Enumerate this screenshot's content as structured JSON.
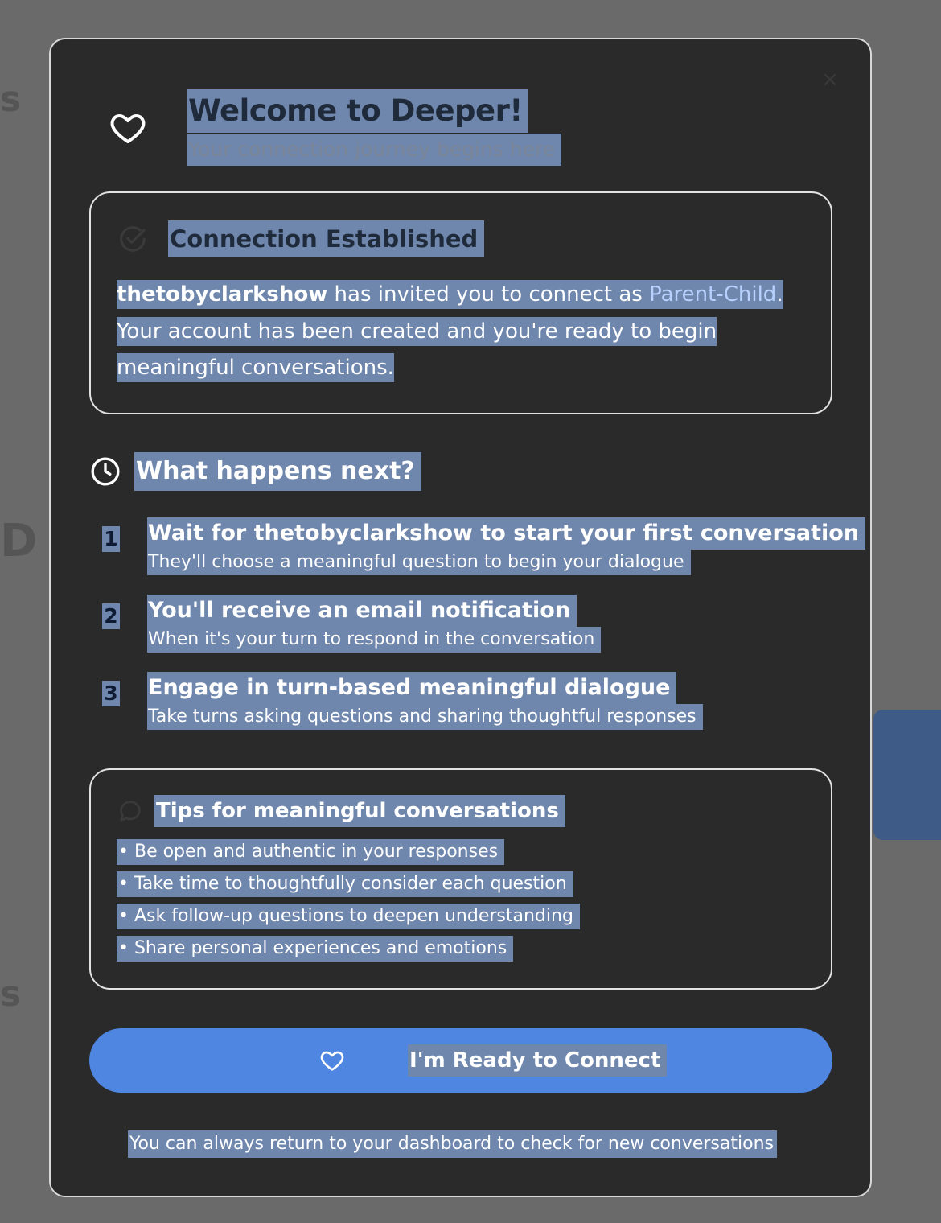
{
  "modal": {
    "close_icon": "close-icon",
    "header_icon": "heart-icon",
    "title": "Welcome to Deeper!",
    "subtitle": "Your connection journey begins here"
  },
  "connection": {
    "icon": "check-circle-icon",
    "title": "Connection Established",
    "inviter": "thetobyclarkshow",
    "text_invited": " has invited you to connect as ",
    "relationship": "Parent-Child",
    "period": ".",
    "line2": "Your account has been created and you're ready to begin",
    "line3": "meaningful conversations."
  },
  "next": {
    "icon": "clock-icon",
    "title": "What happens next?",
    "steps": [
      {
        "num": "1",
        "title": "Wait for thetobyclarkshow to start your first conversation",
        "desc": "They'll choose a meaningful question to begin your dialogue"
      },
      {
        "num": "2",
        "title": "You'll receive an email notification",
        "desc": "When it's your turn to respond in the conversation"
      },
      {
        "num": "3",
        "title": "Engage in turn-based meaningful dialogue",
        "desc": "Take turns asking questions and sharing thoughtful responses"
      }
    ]
  },
  "tips": {
    "icon": "chat-bubble-icon",
    "title": "Tips for meaningful conversations",
    "items": [
      "• Be open and authentic in your responses",
      "• Take time to thoughtfully consider each question",
      "• Ask follow-up questions to deepen understanding",
      "• Share personal experiences and emotions"
    ]
  },
  "cta": {
    "icon": "heart-icon",
    "label": "I'm Ready to Connect"
  },
  "footer": {
    "note": "You can always return to your dashboard to check for new conversations"
  },
  "colors": {
    "modal_bg": "#2a2a2a",
    "accent": "#4f86e2",
    "selection": "#6f87ad",
    "link": "#b8d1ff"
  }
}
